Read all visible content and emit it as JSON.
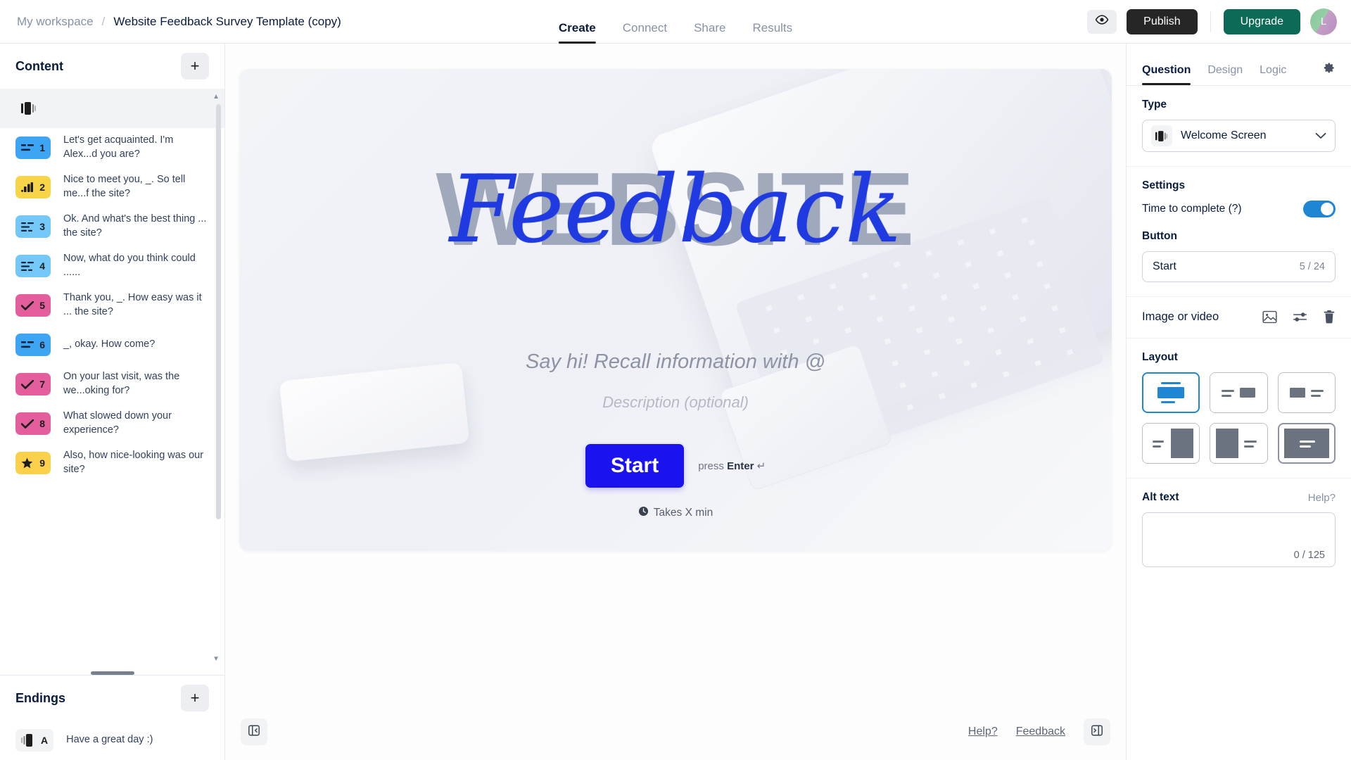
{
  "header": {
    "workspace": "My workspace",
    "separator": "/",
    "form_title": "Website Feedback Survey Template (copy)",
    "tabs": [
      {
        "label": "Create",
        "active": true
      },
      {
        "label": "Connect",
        "active": false
      },
      {
        "label": "Share",
        "active": false
      },
      {
        "label": "Results",
        "active": false
      }
    ],
    "preview_icon": "eye-icon",
    "publish_label": "Publish",
    "upgrade_label": "Upgrade",
    "avatar_initial": "L"
  },
  "sidebar": {
    "content_title": "Content",
    "add_icon": "plus-icon",
    "items": [
      {
        "num": "",
        "icon": "welcome-screen-icon",
        "text": "",
        "badge_color": "#f2f3f5",
        "selected": true
      },
      {
        "num": "1",
        "icon": "short-text-icon",
        "text": "Let's get acquainted. I'm Alex...d you are?",
        "badge_color": "#3da5f4",
        "selected": false
      },
      {
        "num": "2",
        "icon": "opinion-scale-icon",
        "text": "Nice to meet you, _. So tell me...f the site?",
        "badge_color": "#f8d548",
        "selected": false
      },
      {
        "num": "3",
        "icon": "long-text-icon",
        "text": "Ok. And what's the best thing ... the site?",
        "badge_color": "#74c8f7",
        "selected": false
      },
      {
        "num": "4",
        "icon": "long-text-icon",
        "text": "Now, what do you think could ......",
        "badge_color": "#74c8f7",
        "selected": false
      },
      {
        "num": "5",
        "icon": "multiple-choice-icon",
        "text": "Thank you, _. How easy was it ... the site?",
        "badge_color": "#e45d9c",
        "selected": false
      },
      {
        "num": "6",
        "icon": "short-text-icon",
        "text": "_, okay. How come?",
        "badge_color": "#3da5f4",
        "selected": false
      },
      {
        "num": "7",
        "icon": "multiple-choice-icon",
        "text": "On your last visit, was the we...oking for?",
        "badge_color": "#e45d9c",
        "selected": false
      },
      {
        "num": "8",
        "icon": "multiple-choice-icon",
        "text": "What slowed down your experience?",
        "badge_color": "#e45d9c",
        "selected": false
      },
      {
        "num": "9",
        "icon": "rating-icon",
        "text": "Also, how nice-looking was our site?",
        "badge_color": "#fbd14b",
        "selected": false
      }
    ],
    "endings_title": "Endings",
    "endings_add_icon": "plus-icon",
    "endings": [
      {
        "letter": "A",
        "icon": "ending-screen-icon",
        "text": "Have a great day :)"
      }
    ]
  },
  "canvas": {
    "hero_word": "WEBSITE",
    "hero_script": "Feedback",
    "title_placeholder": "Say hi! Recall information with @",
    "description_placeholder": "Description (optional)",
    "start_button": "Start",
    "press_enter_prefix": "press ",
    "press_enter_key": "Enter",
    "press_enter_symbol": "↵",
    "takes_text": "Takes X min",
    "clock_icon": "clock-icon",
    "collapse_left_icon": "panel-collapse-left-icon",
    "collapse_right_icon": "panel-collapse-right-icon",
    "help_link": "Help?",
    "feedback_link": "Feedback"
  },
  "rightpanel": {
    "tabs": [
      {
        "label": "Question",
        "active": true
      },
      {
        "label": "Design",
        "active": false
      },
      {
        "label": "Logic",
        "active": false
      }
    ],
    "gear_icon": "gear-icon",
    "type_label": "Type",
    "type_value": "Welcome Screen",
    "type_icon": "welcome-screen-icon",
    "chevron_icon": "chevron-down-icon",
    "settings_label": "Settings",
    "time_to_complete_label": "Time to complete (?)",
    "time_to_complete_on": true,
    "button_label": "Button",
    "button_value": "Start",
    "button_count": "5 / 24",
    "image_or_video_label": "Image or video",
    "image_icons": [
      "image-icon",
      "adjust-icon",
      "trash-icon"
    ],
    "layout_label": "Layout",
    "layout_options": [
      {
        "name": "layout-stacked-center",
        "selected": true
      },
      {
        "name": "layout-text-left-image-right-small",
        "selected": false
      },
      {
        "name": "layout-image-left-small-text-right",
        "selected": false
      },
      {
        "name": "layout-text-left-image-right-full",
        "selected": false
      },
      {
        "name": "layout-image-left-full-text-right",
        "selected": false
      },
      {
        "name": "layout-image-background",
        "selected": false
      }
    ],
    "alt_text_label": "Alt text",
    "alt_help_label": "Help?",
    "alt_text_value": "",
    "alt_count": "0 / 125"
  },
  "colors": {
    "accent_blue": "#1a13ef",
    "publish_dark": "#262627",
    "upgrade_green": "#0c6b56",
    "toggle_blue": "#1e86d4",
    "layout_selected": "#1e86d4"
  }
}
